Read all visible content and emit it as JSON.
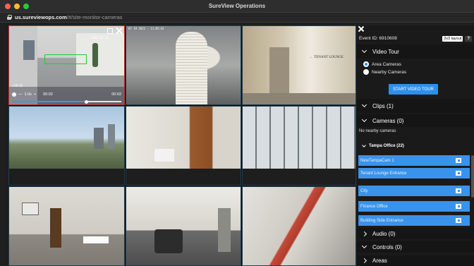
{
  "window": {
    "title": "SureView Operations",
    "url_host": "us.sureviewops.com",
    "url_path": "/#/site-monitor-cameras"
  },
  "active_tile": {
    "timestamp_overlay": "2022-07-11",
    "speed": "1.0x",
    "time_current": "00:02",
    "time_total": "00:02",
    "progress": 0.68,
    "caption": "CAM 02"
  },
  "tile2": {
    "overlay": "07 19 2022  ·  11:05:42"
  },
  "tile3": {
    "sign": "← TENANT LOUNGE"
  },
  "panel": {
    "event_id": "Event ID: 6910608",
    "layout_label": "2x3 layout",
    "help_label": "?",
    "video_tour": {
      "label": "Video Tour",
      "options": [
        "Area Cameras",
        "Nearby Cameras"
      ],
      "selected": "Area Cameras",
      "button_label": "START VIDEO TOUR"
    },
    "clips_label": "Clips (1)",
    "cameras_label": "Cameras (0)",
    "no_cameras_text": "No nearby cameras",
    "group_label": "Tampa Office (22)",
    "camera_list": [
      "NewTampaCam 1",
      "Tenant Lounge Entrance",
      "City",
      "Finance Office",
      "Building Side Entrance"
    ],
    "audio_label": "Audio (0)",
    "controls_label": "Controls (0)",
    "areas_label": "Areas"
  },
  "colors": {
    "accent": "#2f8fea",
    "list_item": "#3a93ea",
    "active_border": "#cc2e2e"
  }
}
